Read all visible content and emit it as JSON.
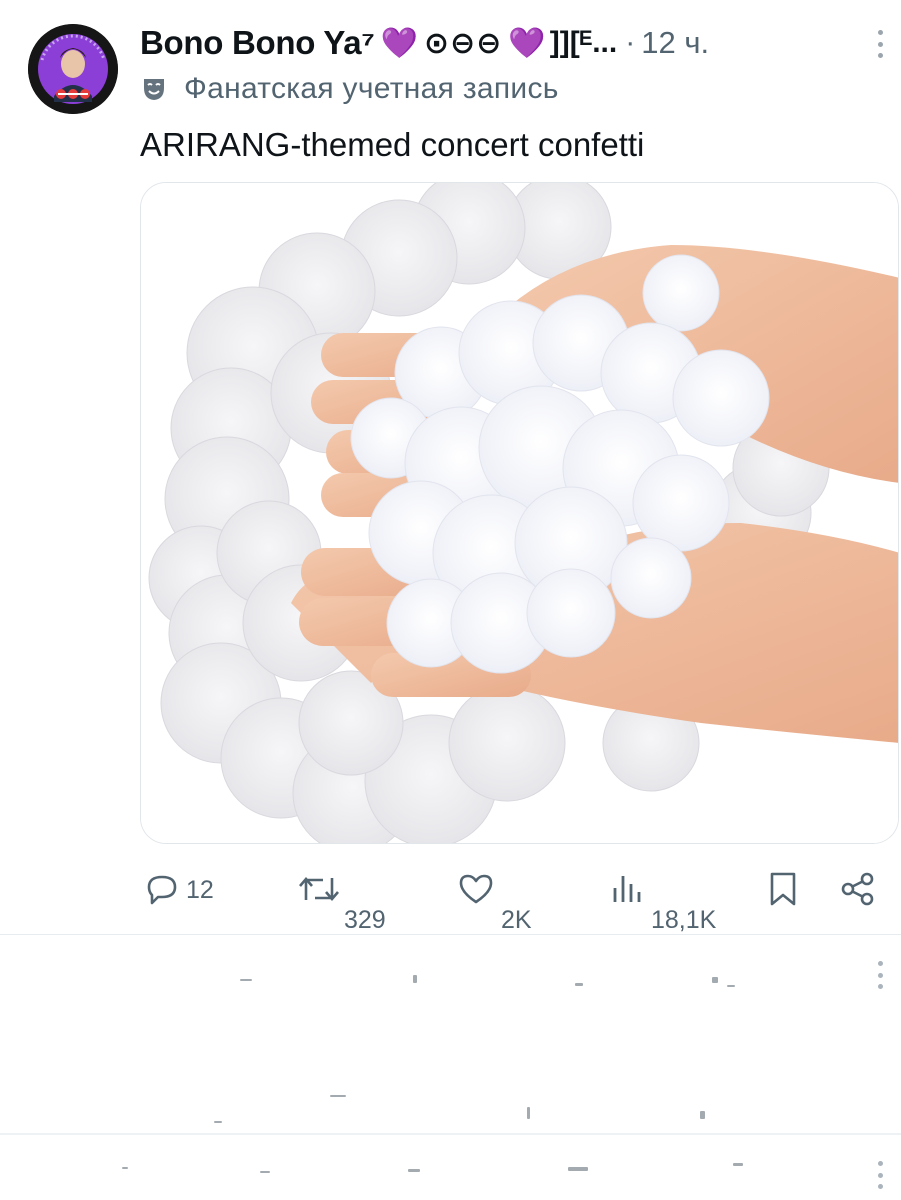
{
  "post": {
    "author": {
      "display_name": "Bono Bono Ya⁷",
      "name_emoji_1": "💜",
      "name_symbols": "⊙⊖⊖",
      "name_emoji_2": "💜",
      "name_tail": "]][ᴱ...",
      "avatar_icon": "profile-avatar-icon"
    },
    "separator": "·",
    "time": "12 ч.",
    "account_label": {
      "icon": "theater-mask-icon",
      "text": "Фанатская учетная запись"
    },
    "text": "ARIRANG-themed concert confetti",
    "media": {
      "kind": "photo",
      "icon": "confetti-photo"
    },
    "actions": {
      "reply": {
        "icon": "reply-icon",
        "count": "12"
      },
      "repost": {
        "icon": "repost-icon",
        "count": "329"
      },
      "like": {
        "icon": "heart-icon",
        "count": "2K"
      },
      "views": {
        "icon": "views-icon",
        "count": "18,1K"
      },
      "bookmark": {
        "icon": "bookmark-icon"
      },
      "share": {
        "icon": "share-icon"
      }
    },
    "colors": {
      "text": "#0f1419",
      "secondary": "#536471",
      "border": "#e1e6ea",
      "accent_purple": "#9b4ce6"
    }
  },
  "feed": {
    "state": "loading",
    "more_icon": "more-vertical-icon"
  }
}
